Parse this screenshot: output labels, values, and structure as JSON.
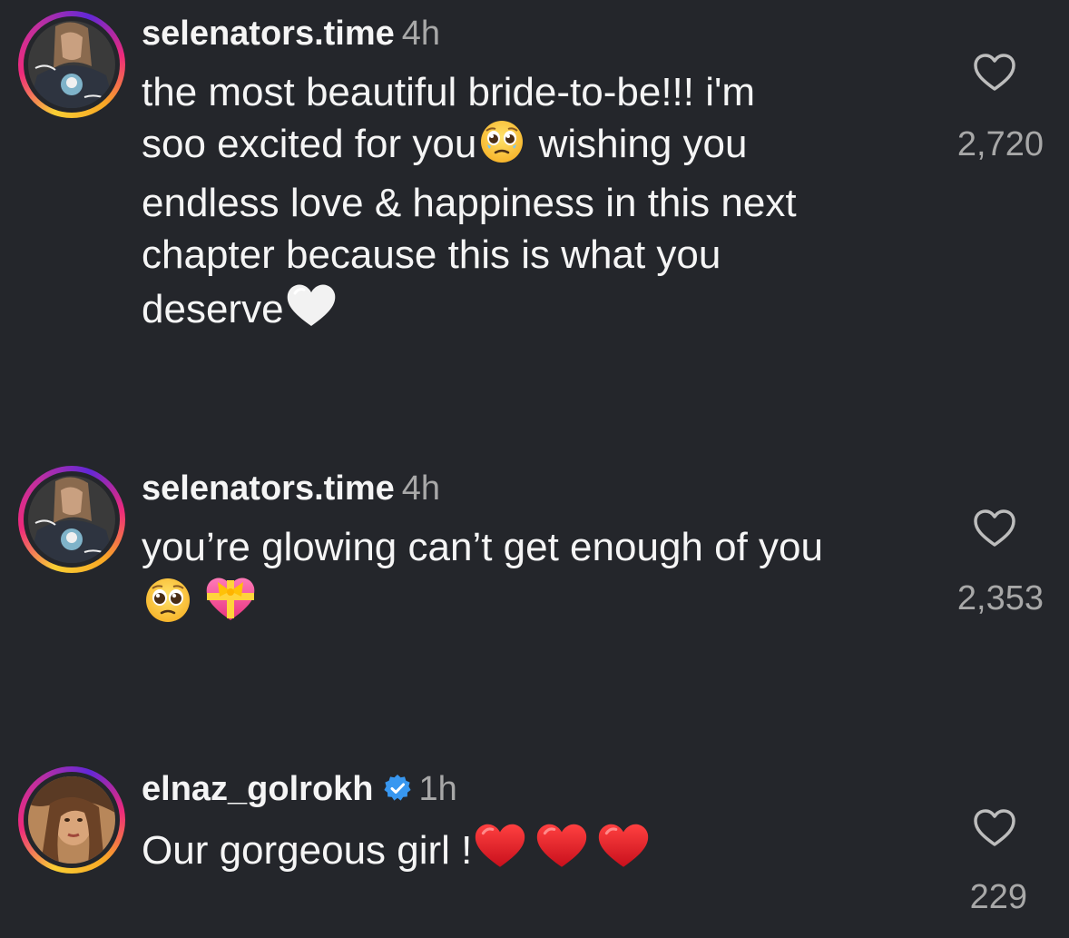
{
  "comments": [
    {
      "username": "selenators.time",
      "time": "4h",
      "verified": false,
      "lines": [
        "the most beautiful bride-to-be!!! i'm",
        "soo excited for you",
        " wishing you",
        "endless love & happiness in this next",
        "chapter because this is what you",
        "deserve"
      ],
      "emojis": [
        "face-holding-back-tears-emoji",
        "white-heart-emoji"
      ],
      "likes": "2,720"
    },
    {
      "username": "selenators.time",
      "time": "4h",
      "verified": false,
      "lines": [
        "you’re glowing can’t get enough of you"
      ],
      "emojis": [
        "pleading-face-emoji",
        "heart-with-ribbon-emoji"
      ],
      "likes": "2,353"
    },
    {
      "username": "elnaz_golrokh",
      "time": "1h",
      "verified": true,
      "lines": [
        "Our gorgeous girl !"
      ],
      "emojis": [
        "red-heart-emoji",
        "red-heart-emoji",
        "red-heart-emoji"
      ],
      "likes": "229"
    }
  ],
  "colors": {
    "background": "#24262b",
    "text": "#f5f5f5",
    "muted": "#a8a8a8",
    "verified": "#3897f0"
  },
  "icons": {
    "like": "heart-outline-icon",
    "verified": "verified-badge-icon"
  }
}
